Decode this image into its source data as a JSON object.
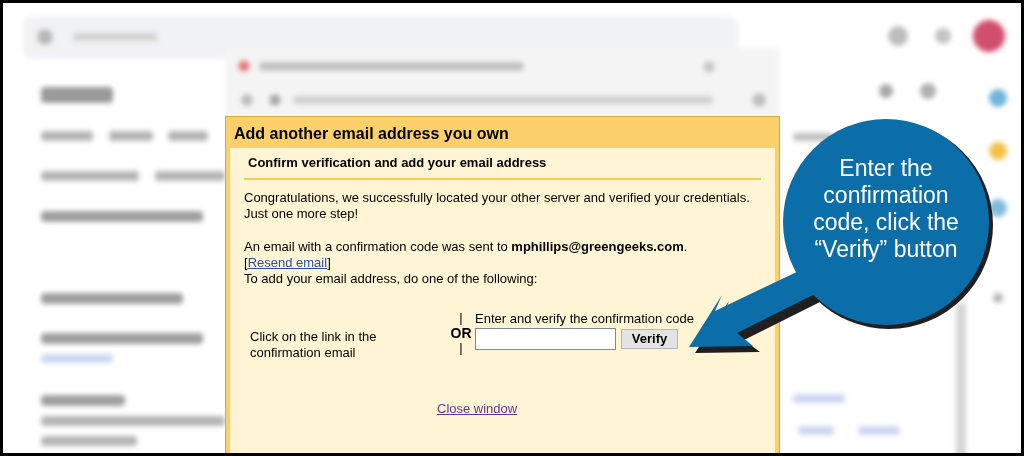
{
  "dialog": {
    "title": "Add another email address you own",
    "subtitle": "Confirm verification and add your email address",
    "intro": "Congratulations, we successfully located your other server and verified your credentials. Just one more step!",
    "sent_message": "An email with a confirmation code was sent to **mphillips@greengeeks.com**.",
    "resend": {
      "open": "[",
      "link": "Resend email",
      "close": "]"
    },
    "instruction": "To add your email address, do one of the following:",
    "link_option": "Click on the link in the confirmation email",
    "separator": [
      "|",
      "OR",
      "|"
    ],
    "code_label": "Enter and verify the confirmation code",
    "verify_button": "Verify",
    "close_link": "Close window"
  },
  "callout": {
    "text": "Enter the confirmation code, click the “Verify” button"
  }
}
